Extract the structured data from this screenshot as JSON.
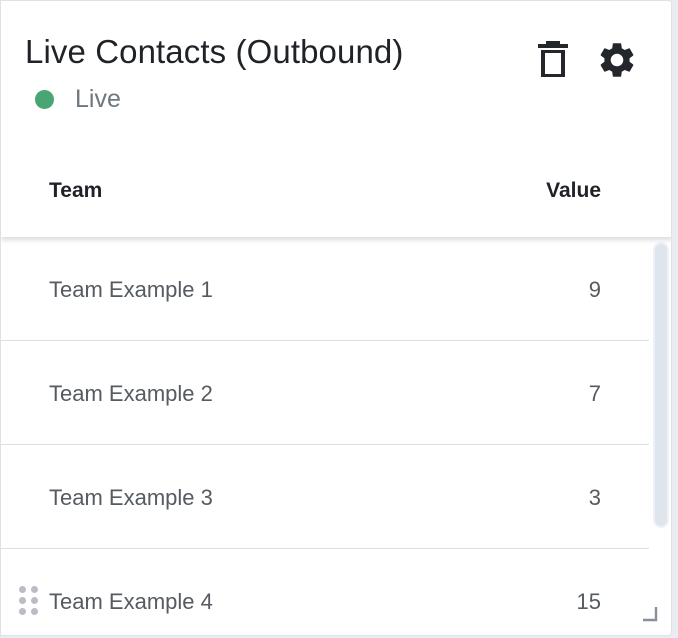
{
  "widget": {
    "title": "Live Contacts (Outbound)",
    "status": {
      "label": "Live",
      "color": "#4aa574"
    },
    "actions": [
      {
        "name": "delete",
        "icon": "trash-icon"
      },
      {
        "name": "settings",
        "icon": "gear-icon"
      }
    ],
    "columns": {
      "team": "Team",
      "value": "Value"
    },
    "rows": [
      {
        "team": "Team Example 1",
        "value": "9"
      },
      {
        "team": "Team Example 2",
        "value": "7"
      },
      {
        "team": "Team Example 3",
        "value": "3"
      },
      {
        "team": "Team Example 4",
        "value": "15"
      }
    ]
  }
}
